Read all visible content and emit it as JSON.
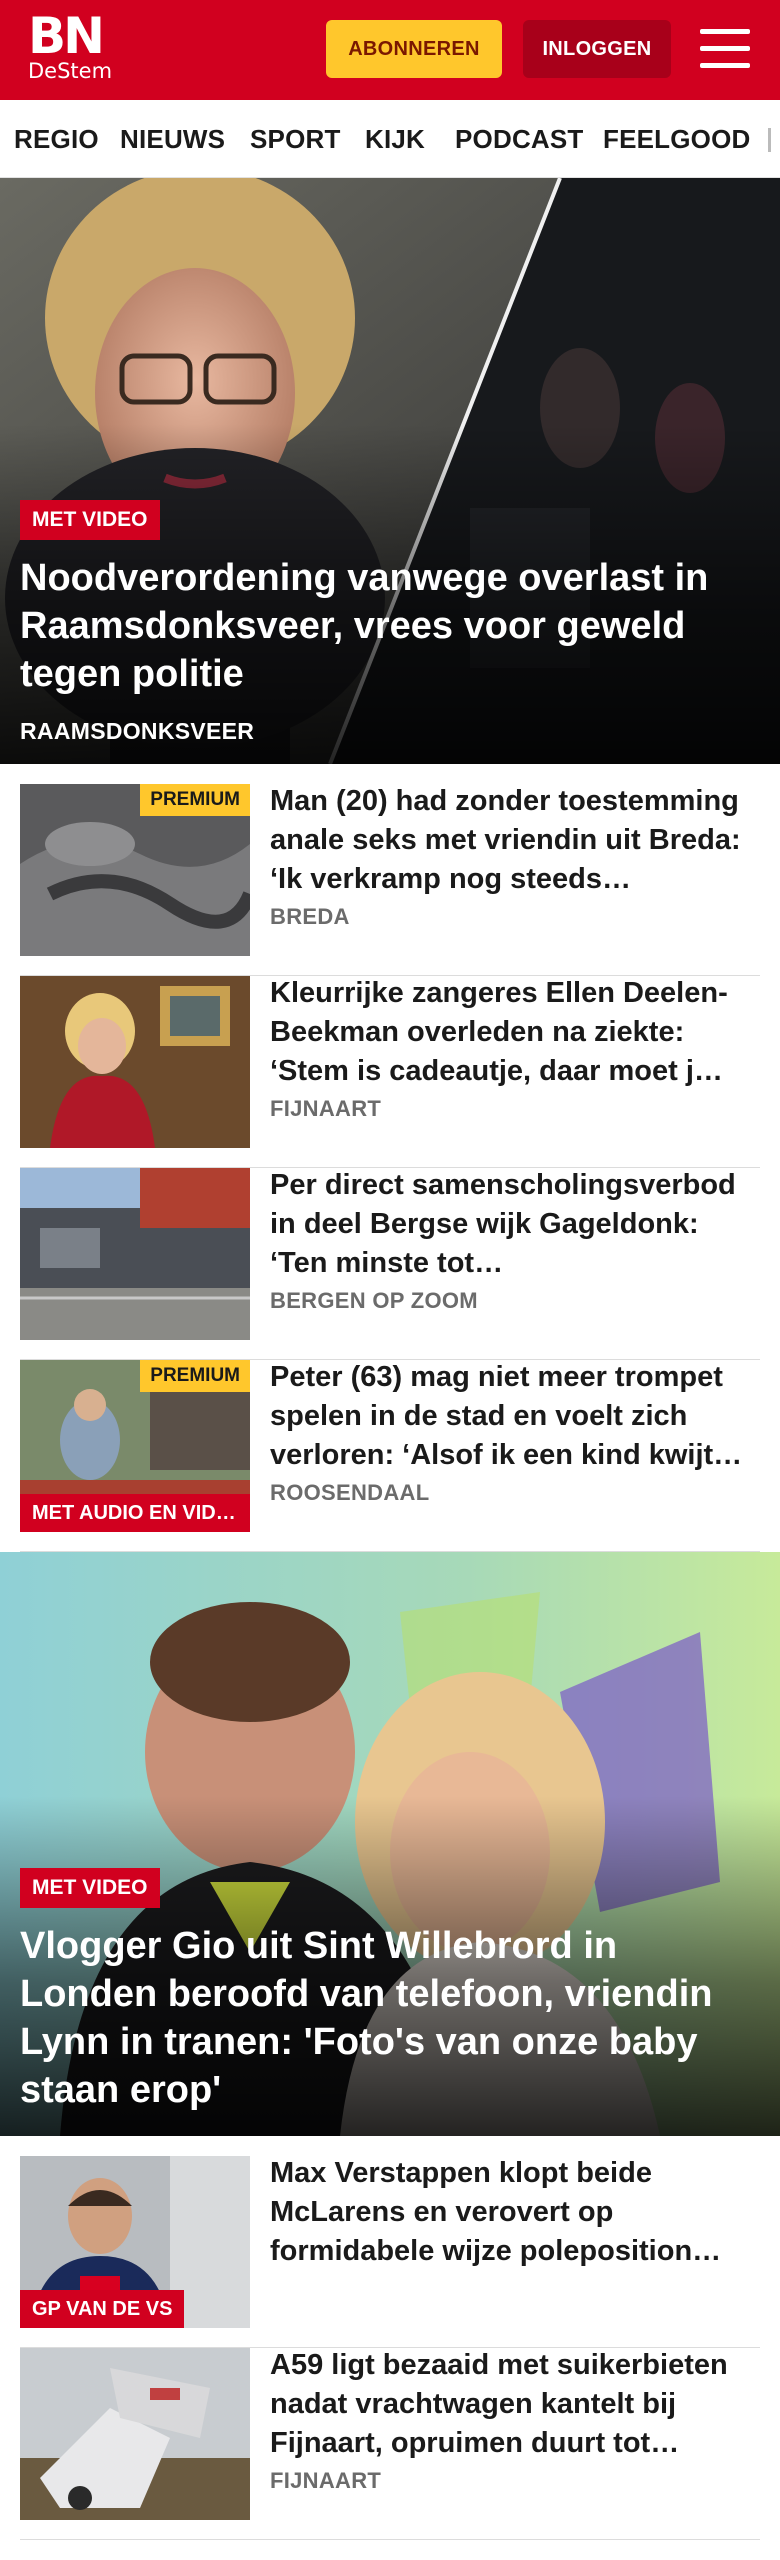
{
  "header": {
    "logo_main": "BN",
    "logo_sub": "DeStem",
    "subscribe_label": "ABONNEREN",
    "login_label": "INLOGGEN",
    "menu_icon": "hamburger-menu-icon",
    "brand_color": "#d1001f",
    "accent_color": "#ffc72c"
  },
  "nav": {
    "items": [
      "REGIO",
      "NIEUWS",
      "SPORT",
      "KIJK",
      "PODCAST",
      "FEELGOOD"
    ]
  },
  "hero1": {
    "label": "MET VIDEO",
    "title": "Noodverordening vanwege overlast in Raamsdonksveer, vrees voor geweld tegen politie",
    "location": "RAAMSDONKSVEER"
  },
  "articles1": [
    {
      "premium": "PREMIUM",
      "title": "Man (20) had zonder toestemming anale seks met vriendin uit Breda: ‘Ik verkramp nog steeds…",
      "location": "BREDA"
    },
    {
      "title": "Kleurrijke zangeres Ellen Deelen-Beekman overleden na ziekte: ‘Stem is cadeautje, daar moet j…",
      "location": "FIJNAART"
    },
    {
      "title": "Per direct samenscholingsverbod in deel Bergse wijk Gageldonk: ‘Ten minste tot…",
      "location": "BERGEN OP ZOOM"
    },
    {
      "premium": "PREMIUM",
      "label": "MET AUDIO EN VIDEO",
      "title": "Peter (63) mag niet meer trompet spelen in de stad en voelt zich verloren: ‘Alsof ik een kind kwijt…",
      "location": "ROOSENDAAL"
    }
  ],
  "hero2": {
    "label": "MET VIDEO",
    "title": "Vlogger Gio uit Sint Willebrord in Londen beroofd van telefoon, vriendin Lynn in tranen: 'Foto's van onze baby staan erop'"
  },
  "articles2": [
    {
      "label": "GP VAN DE VS",
      "title": "Max Verstappen klopt beide McLarens en verovert op formidabele wijze poleposition…",
      "location": ""
    },
    {
      "title": "A59 ligt bezaaid met suikerbieten nadat vrachtwagen kantelt bij Fijnaart, opruimen duurt tot…",
      "location": "FIJNAART"
    }
  ]
}
